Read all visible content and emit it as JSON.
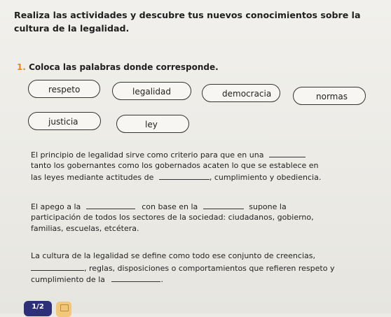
{
  "header": {
    "title": "Realiza las actividades y descubre tus nuevos conocimientos sobre la cultura de la legalidad."
  },
  "exercise": {
    "number": "1.",
    "instruction": "Coloca las palabras donde corresponde."
  },
  "word_bank": [
    "respeto",
    "legalidad",
    "democracia",
    "normas",
    "justicia",
    "ley"
  ],
  "paragraphs": {
    "p1": {
      "a": "El principio de legalidad sirve como criterio para que en una",
      "b": "tanto los gobernantes como los gobernados acaten lo que se establece en",
      "c": "las leyes mediante actitudes de",
      "d": ", cumplimiento y obediencia."
    },
    "p2": {
      "a": "El apego a la",
      "b": "con base en la",
      "c": "supone la",
      "d": "participación de todos los sectores de la sociedad: ciudadanos, gobierno,",
      "e": "familias, escuelas, etcétera."
    },
    "p3": {
      "a": "La cultura de la legalidad se define como todo ese conjunto de creencias,",
      "b": ", reglas, disposiciones o comportamientos que refieren respeto y",
      "c": "cumplimiento de la",
      "d": "."
    }
  },
  "footer": {
    "page_badge": "1/2",
    "calculator_icon": "calculator-icon"
  }
}
